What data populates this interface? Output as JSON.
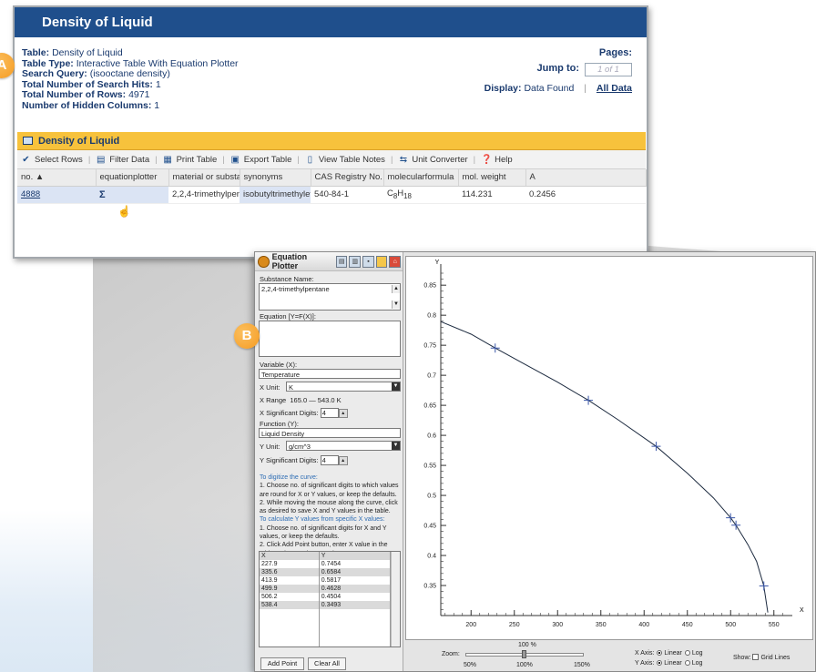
{
  "table_window": {
    "title": "Density of Liquid",
    "info": {
      "table_label": "Table:",
      "table_value": "Density of Liquid",
      "table_type_label": "Table Type:",
      "table_type_value": "Interactive Table With Equation Plotter",
      "search_query_label": "Search Query:",
      "search_query_value": "(isooctane density)",
      "search_hits_label": "Total Number of Search Hits:",
      "search_hits_value": "1",
      "rows_label": "Total Number of Rows:",
      "rows_value": "4971",
      "hidden_cols_label": "Number of Hidden Columns:",
      "hidden_cols_value": "1"
    },
    "pages": {
      "label": "Pages:",
      "jump_label": "Jump to:",
      "jump_value": "1 of 1",
      "display_label": "Display:",
      "data_found": "Data Found",
      "separator": "|",
      "all_data": "All Data"
    },
    "grid_title": "Density of Liquid",
    "toolbar": [
      "Select Rows",
      "Filter Data",
      "Print Table",
      "Export Table",
      "View Table Notes",
      "Unit Converter",
      "Help"
    ],
    "columns": [
      "no. ▲",
      "equationplotter",
      "material or substance",
      "synonyms",
      "CAS Registry No.",
      "molecularformula",
      "mol. weight",
      "A"
    ],
    "row": {
      "no": "4888",
      "equation": "Σ",
      "material": "2,2,4-trimethylpentane",
      "synonyms": "isobutyltrimethylethane",
      "cas": "540-84-1",
      "formula_prefix": "C",
      "formula_sub1": "8",
      "formula_mid": "H",
      "formula_sub2": "18",
      "mol_weight": "114.231",
      "a": "0.2456"
    }
  },
  "badges": {
    "a": "A",
    "b": "B"
  },
  "plotter": {
    "title": "Equation Plotter",
    "substance_label": "Substance Name:",
    "substance_value": "2,2,4-trimethylpentane",
    "equation_label": "Equation [Y=F(X)]:",
    "variable_label": "Variable (X):",
    "variable_value": "Temperature",
    "x_unit_label": "X Unit:",
    "x_unit_value": "K",
    "x_range_label": "X Range",
    "x_range_value": "165.0 — 543.0 K",
    "x_sig_label": "X Significant Digits:",
    "x_sig_value": "4",
    "function_label": "Function (Y):",
    "function_value": "Liquid Density",
    "y_unit_label": "Y Unit:",
    "y_unit_value": "g/cm^3",
    "y_sig_label": "Y Significant Digits:",
    "y_sig_value": "4",
    "ins1_head": "To digitize the curve:",
    "ins1_1": "1. Choose no. of significant digits to which values are round for X or Y values, or keep the defaults.",
    "ins1_2": "2. While moving the mouse along the curve, click as desired to save X and Y values in the table.",
    "ins2_head": "To calculate Y values from specific X values:",
    "ins2_1": "1. Choose no. of significant digits for X and Y values, or keep the defaults.",
    "ins2_2": "2. Click Add Point button, enter X value in the table and press the Enter key.",
    "table_headers": [
      "X",
      "Y"
    ],
    "table_rows": [
      [
        "227.9",
        "0.7454"
      ],
      [
        "335.6",
        "0.6584"
      ],
      [
        "413.9",
        "0.5817"
      ],
      [
        "499.9",
        "0.4628"
      ],
      [
        "506.2",
        "0.4504"
      ],
      [
        "538.4",
        "0.3493"
      ]
    ],
    "add_point": "Add Point",
    "clear_all": "Clear All",
    "zoom_label": "Zoom:",
    "zoom_value": "100 %",
    "zoom_min": "50%",
    "zoom_mid": "100%",
    "zoom_max": "150%",
    "x_axis_label": "X Axis:",
    "y_axis_label": "Y Axis:",
    "linear": "Linear",
    "log": "Log",
    "show_label": "Show:",
    "grid_lines": "Grid Lines"
  },
  "chart_data": {
    "type": "line",
    "xlabel": "X",
    "ylabel": "Y",
    "xlim": [
      165,
      565
    ],
    "ylim": [
      0.3,
      0.87
    ],
    "xticks": [
      200,
      250,
      300,
      350,
      400,
      450,
      500,
      550
    ],
    "yticks": [
      0.35,
      0.4,
      0.45,
      0.5,
      0.55,
      0.6,
      0.65,
      0.7,
      0.75,
      0.8,
      0.85
    ],
    "curve": {
      "x": [
        165,
        200,
        227.9,
        260,
        300,
        335.6,
        370,
        413.9,
        450,
        480,
        499.9,
        506.2,
        520,
        530,
        538.4,
        543
      ],
      "y": [
        0.7894,
        0.7685,
        0.7454,
        0.72,
        0.6885,
        0.6584,
        0.626,
        0.5817,
        0.537,
        0.496,
        0.4628,
        0.4504,
        0.418,
        0.39,
        0.3493,
        0.305
      ]
    },
    "points": {
      "x": [
        227.9,
        335.6,
        413.9,
        499.9,
        506.2,
        538.4
      ],
      "y": [
        0.7454,
        0.6584,
        0.5817,
        0.4628,
        0.4504,
        0.3493
      ]
    },
    "grid": false,
    "x_scale": "linear",
    "y_scale": "linear"
  }
}
